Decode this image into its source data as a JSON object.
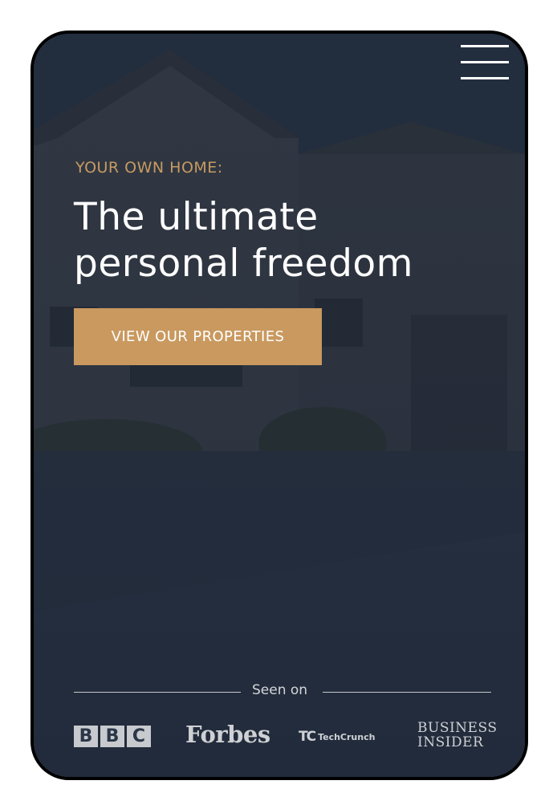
{
  "hero": {
    "eyebrow": "YOUR OWN HOME:",
    "headline_line1": "The ultimate",
    "headline_line2": "personal freedom",
    "cta_label": "VIEW OUR PROPERTIES"
  },
  "menu": {
    "icon": "hamburger-menu-icon"
  },
  "seen_on": {
    "label": "Seen on",
    "logos": {
      "bbc": [
        "B",
        "B",
        "C"
      ],
      "forbes": "Forbes",
      "techcrunch_mark": "TC",
      "techcrunch_text": "TechCrunch",
      "business_insider_line1": "BUSINESS",
      "business_insider_line2": "INSIDER"
    }
  },
  "colors": {
    "accent": "#c9995f",
    "background": "#1f2a38"
  }
}
